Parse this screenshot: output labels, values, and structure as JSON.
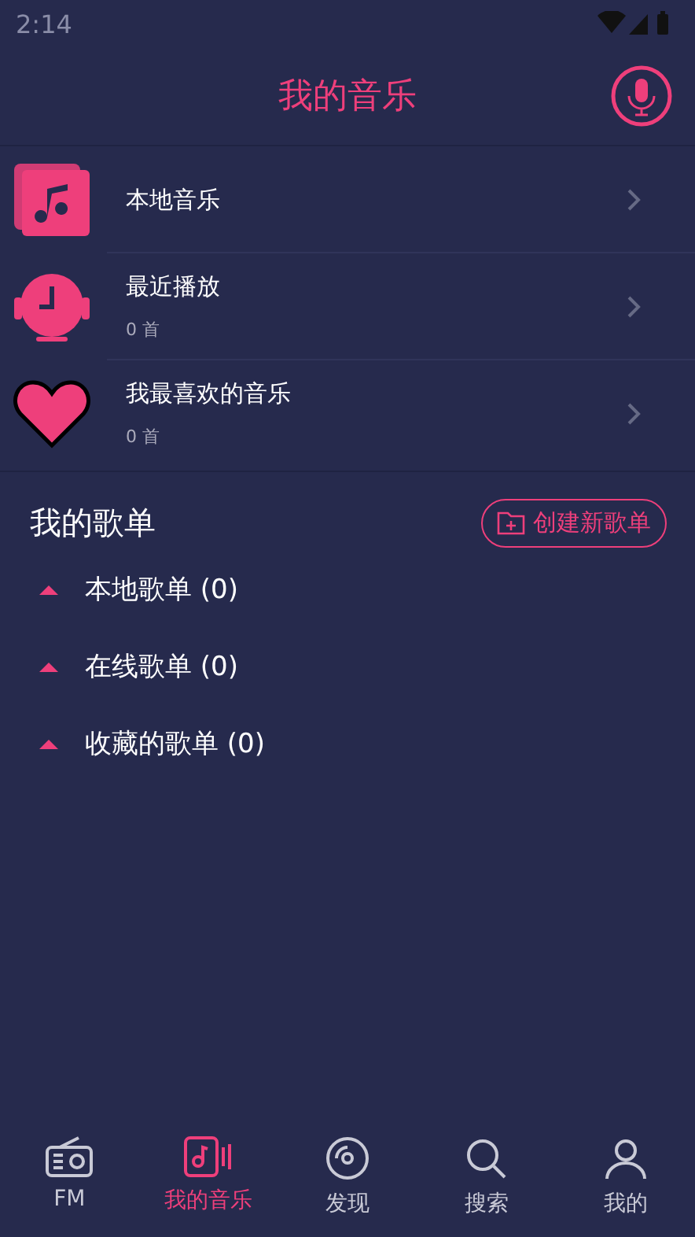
{
  "status_bar": {
    "time": "2:14"
  },
  "header": {
    "title": "我的音乐"
  },
  "library": [
    {
      "kind": "local",
      "title": "本地音乐"
    },
    {
      "kind": "recent",
      "title": "最近播放",
      "count": "0 首"
    },
    {
      "kind": "favorite",
      "title": "我最喜欢的音乐",
      "count": "0 首"
    }
  ],
  "playlists": {
    "title": "我的歌单",
    "create_button": "创建新歌单",
    "groups": [
      {
        "label": "本地歌单 (0)",
        "expanded": true
      },
      {
        "label": "在线歌单 (0)",
        "expanded": true
      },
      {
        "label": "收藏的歌单 (0)",
        "expanded": true
      }
    ]
  },
  "bottom_nav": [
    {
      "kind": "radio",
      "label": "FM",
      "selected": false
    },
    {
      "kind": "music",
      "label": "我的音乐",
      "selected": true
    },
    {
      "kind": "disc",
      "label": "发现",
      "selected": false
    },
    {
      "kind": "search",
      "label": "搜索",
      "selected": false
    },
    {
      "kind": "user",
      "label": "我的",
      "selected": false
    }
  ]
}
